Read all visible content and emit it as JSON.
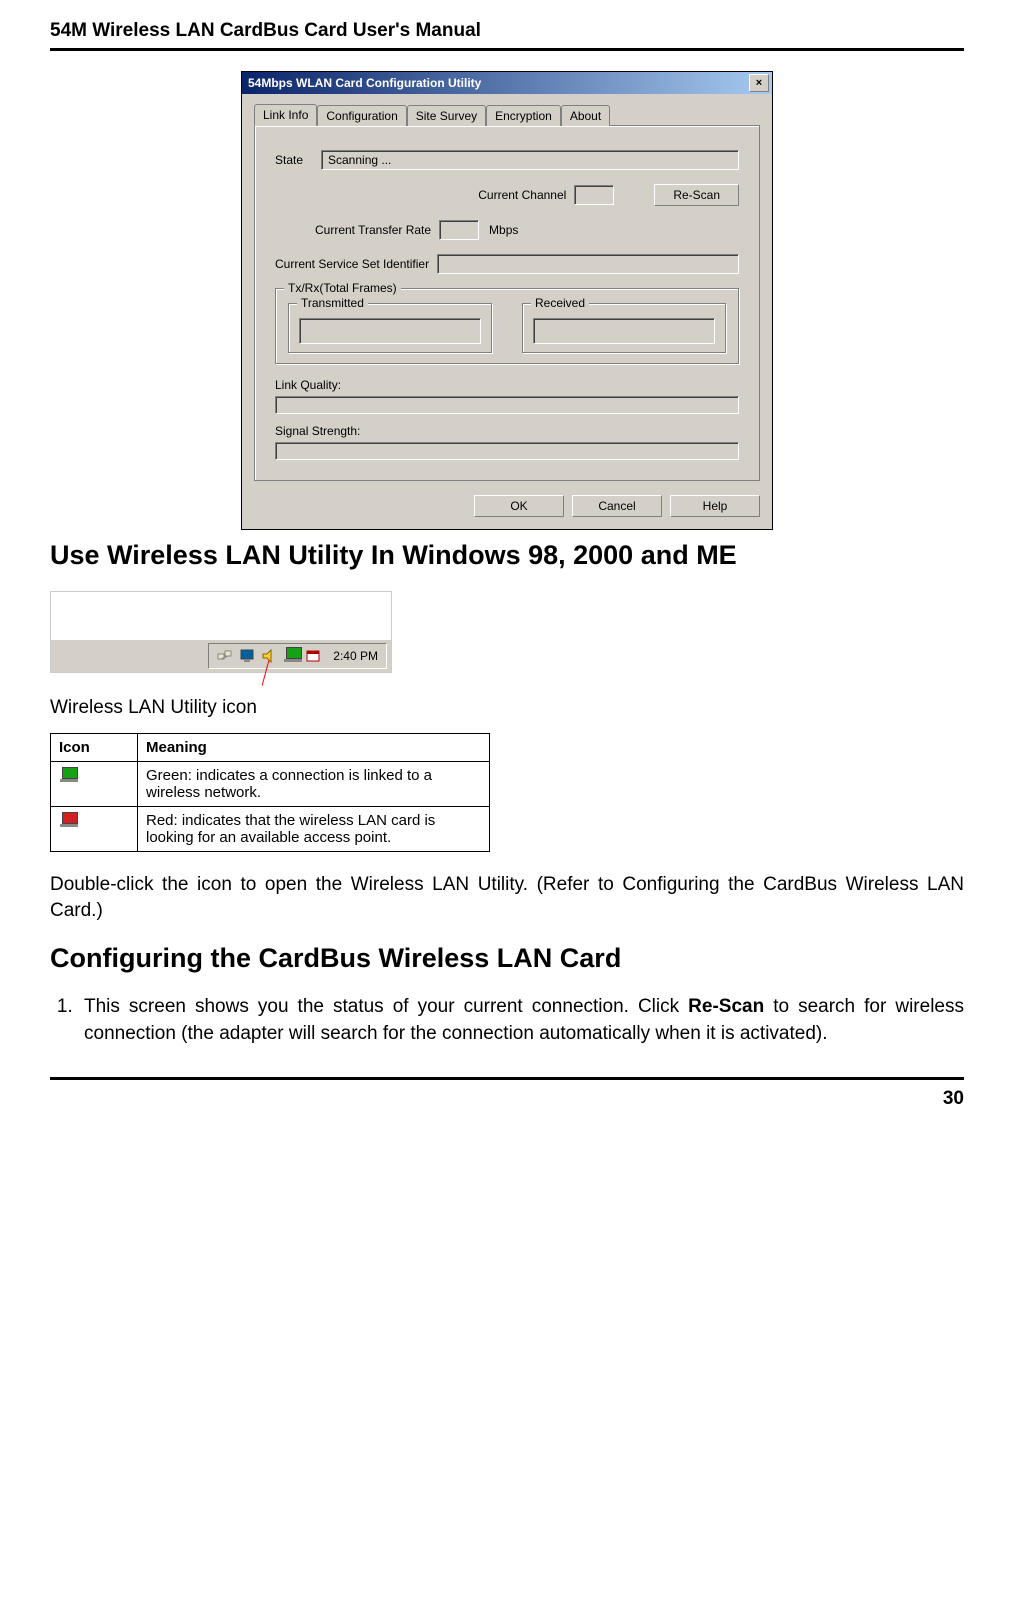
{
  "header": {
    "title": "54M Wireless LAN CardBus Card User's Manual"
  },
  "dialog": {
    "title": "54Mbps WLAN Card Configuration Utility",
    "close": "×",
    "tabs": [
      "Link Info",
      "Configuration",
      "Site Survey",
      "Encryption",
      "About"
    ],
    "active_tab": 0,
    "state_label": "State",
    "state_value": "Scanning ...",
    "current_channel_label": "Current Channel",
    "current_channel_value": "",
    "rescan_label": "Re-Scan",
    "transfer_rate_label": "Current Transfer Rate",
    "transfer_rate_value": "",
    "transfer_rate_unit": "Mbps",
    "ssid_label": "Current Service Set Identifier",
    "ssid_value": "",
    "txrx_group": "Tx/Rx(Total Frames)",
    "tx_label": "Transmitted",
    "tx_value": "",
    "rx_label": "Received",
    "rx_value": "",
    "link_quality_label": "Link Quality:",
    "signal_strength_label": "Signal Strength:",
    "ok_label": "OK",
    "cancel_label": "Cancel",
    "help_label": "Help"
  },
  "section1_heading": "Use Wireless LAN Utility In Windows 98, 2000 and ME",
  "systray": {
    "time": "2:40 PM"
  },
  "icon_caption": "Wireless LAN Utility icon",
  "table": {
    "col_icon": "Icon",
    "col_meaning": "Meaning",
    "green_text": "Green: indicates a connection is linked to a wireless network.",
    "red_text": "Red: indicates that the wireless LAN card is looking for an available access point."
  },
  "para_doubleclick": "Double-click the icon to open the Wireless LAN Utility. (Refer to Configuring the CardBus Wireless LAN Card.)",
  "section2_heading": "Configuring the CardBus Wireless LAN Card",
  "step1_pre": "This screen shows you the status of your current connection. Click ",
  "step1_bold": "Re-Scan",
  "step1_post": " to search for wireless connection (the adapter will search for the connection automatically when it is activated).",
  "footer": {
    "page": "30"
  }
}
